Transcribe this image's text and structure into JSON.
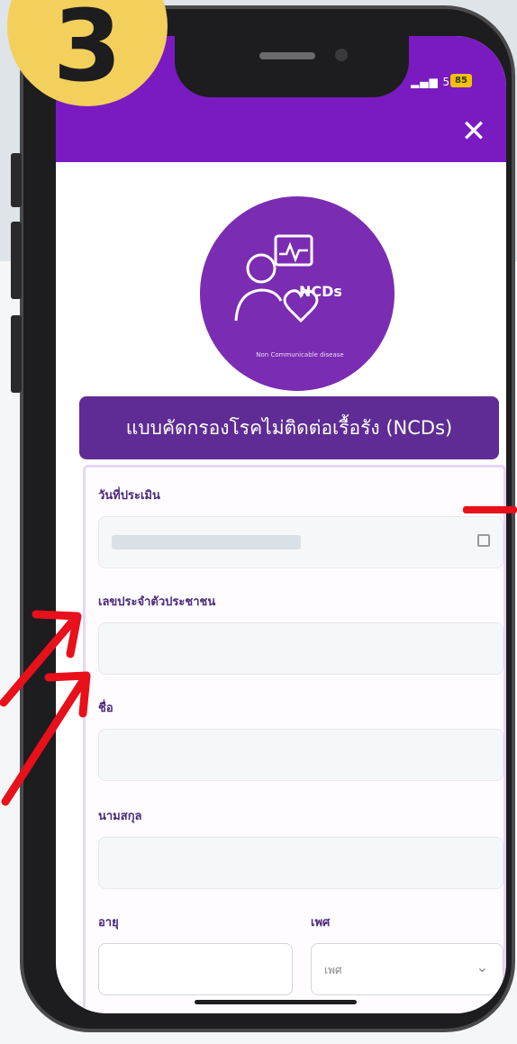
{
  "badge": {
    "number": "3"
  },
  "status_bar": {
    "network": "5G",
    "battery": "85"
  },
  "header": {
    "close_label": "✕"
  },
  "logo": {
    "ncds_text": "NCDs",
    "subtitle": "Non Communicable disease"
  },
  "form": {
    "title": "แบบคัดกรองโรคไม่ติดต่อเรื้อรัง (NCDs)",
    "fields": [
      {
        "label": "วันที่ประเมิน",
        "value": "",
        "icon": "calendar-icon"
      },
      {
        "label": "เลขประจำตัวประชาชน",
        "value": ""
      },
      {
        "label": "ชื่อ",
        "value": ""
      },
      {
        "label": "นามสกุล",
        "value": ""
      }
    ],
    "age_label": "อายุ",
    "sex_label": "เพศ",
    "sex_select": {
      "selected": "เพศ"
    }
  },
  "colors": {
    "brand_purple": "#7a1bc2",
    "header_purple": "#5e2c94",
    "badge_yellow": "#f3cf5c",
    "annotation_red": "#e8101a"
  }
}
